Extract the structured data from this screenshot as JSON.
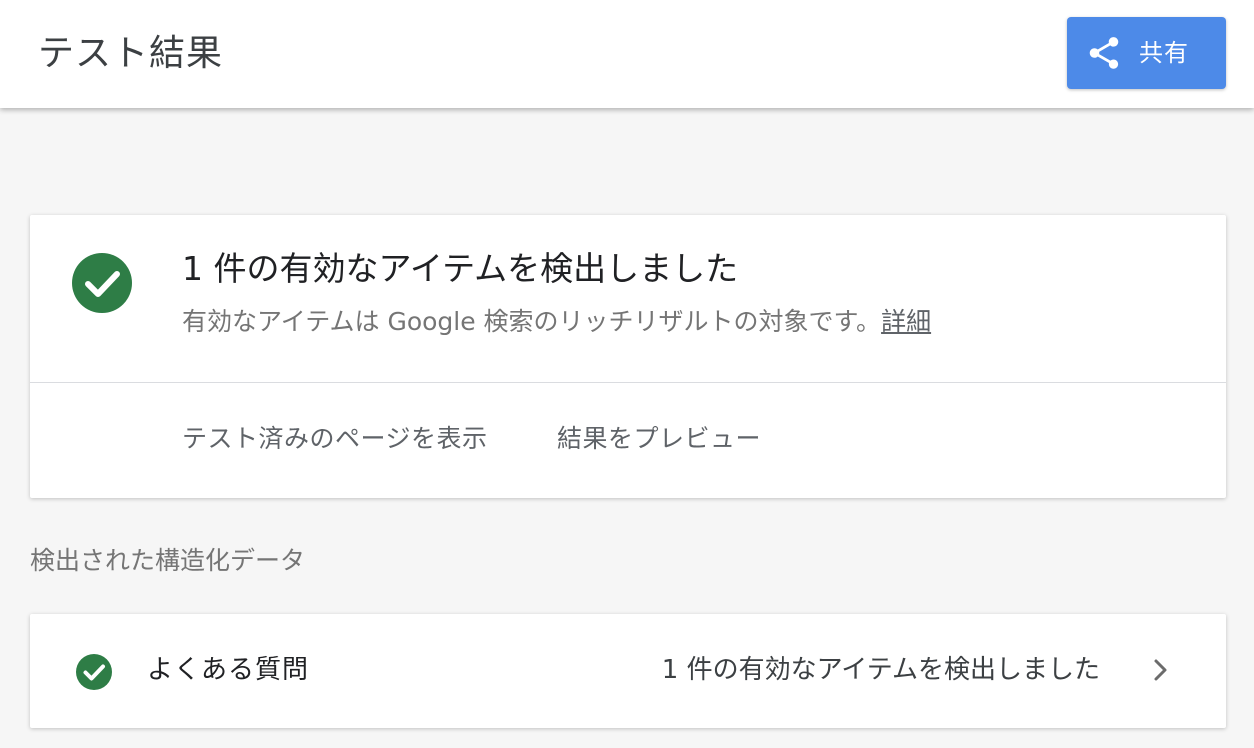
{
  "header": {
    "title": "テスト結果",
    "share_label": "共有",
    "share_icon": "share-icon",
    "accent_color": "#4d8ae8"
  },
  "summary": {
    "status_icon": "check-circle-icon",
    "status_color": "#2e7d46",
    "title": "1 件の有効なアイテムを検出しました",
    "subtitle": "有効なアイテムは Google 検索のリッチリザルトの対象です。",
    "details_link": "詳細",
    "actions": [
      {
        "label": "テスト済みのページを表示"
      },
      {
        "label": "結果をプレビュー"
      }
    ]
  },
  "structured_data": {
    "heading": "検出された構造化データ",
    "items": [
      {
        "name": "よくある質問",
        "status": "1 件の有効なアイテムを検出しました",
        "status_icon": "check-circle-icon",
        "chevron_icon": "chevron-right-icon"
      }
    ]
  }
}
